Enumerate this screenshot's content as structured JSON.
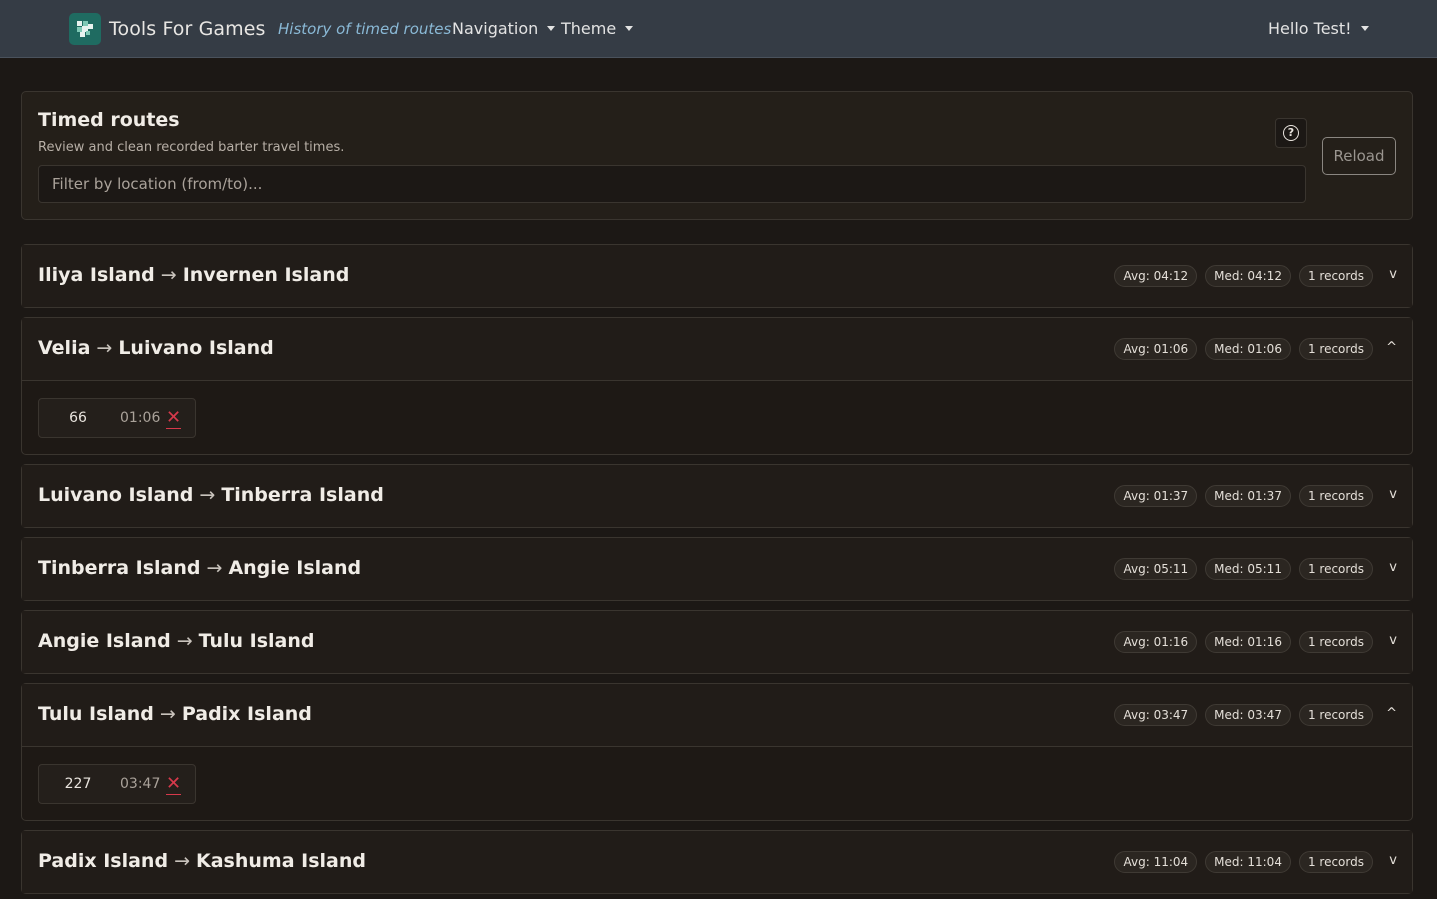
{
  "navbar": {
    "brand": "Tools For Games",
    "links": {
      "history": "History of timed routes",
      "navigation": "Navigation",
      "theme": "Theme",
      "user": "Hello Test!"
    }
  },
  "header_card": {
    "title": "Timed routes",
    "subtitle": "Review and clean recorded barter travel times.",
    "filter_placeholder": "Filter by location (from/to)...",
    "help_glyph": "?",
    "reload_label": "Reload"
  },
  "routes": [
    {
      "from": "Iliya Island",
      "to": "Invernen Island",
      "avg": "Avg: 04:12",
      "med": "Med: 04:12",
      "count": "1 records",
      "toggle": "v",
      "expanded": false
    },
    {
      "from": "Velia",
      "to": "Luivano Island",
      "avg": "Avg: 01:06",
      "med": "Med: 01:06",
      "count": "1 records",
      "toggle": "^",
      "expanded": true,
      "records": [
        {
          "id": "66",
          "time": "01:06",
          "delete": "✕"
        }
      ]
    },
    {
      "from": "Luivano Island",
      "to": "Tinberra Island",
      "avg": "Avg: 01:37",
      "med": "Med: 01:37",
      "count": "1 records",
      "toggle": "v",
      "expanded": false
    },
    {
      "from": "Tinberra Island",
      "to": "Angie Island",
      "avg": "Avg: 05:11",
      "med": "Med: 05:11",
      "count": "1 records",
      "toggle": "v",
      "expanded": false
    },
    {
      "from": "Angie Island",
      "to": "Tulu Island",
      "avg": "Avg: 01:16",
      "med": "Med: 01:16",
      "count": "1 records",
      "toggle": "v",
      "expanded": false
    },
    {
      "from": "Tulu Island",
      "to": "Padix Island",
      "avg": "Avg: 03:47",
      "med": "Med: 03:47",
      "count": "1 records",
      "toggle": "^",
      "expanded": true,
      "records": [
        {
          "id": "227",
          "time": "03:47",
          "delete": "✕"
        }
      ]
    },
    {
      "from": "Padix Island",
      "to": "Kashuma Island",
      "avg": "Avg: 11:04",
      "med": "Med: 11:04",
      "count": "1 records",
      "toggle": "v",
      "expanded": false
    }
  ],
  "arrow_glyph": "→"
}
